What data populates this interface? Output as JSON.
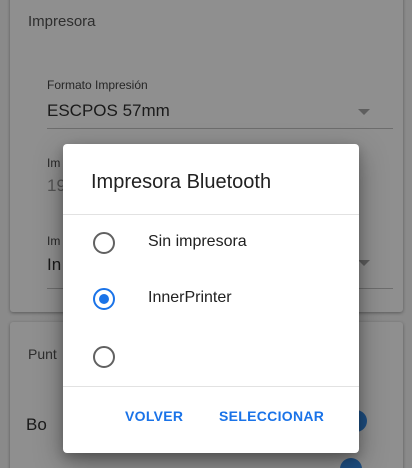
{
  "background": {
    "card1": {
      "section_title": "Impresora",
      "fields": [
        {
          "label": "Formato Impresión",
          "value": "ESCPOS 57mm"
        },
        {
          "label": "Im",
          "value": "19"
        },
        {
          "label": "Im",
          "value": "In"
        }
      ]
    },
    "card2": {
      "section_title": "Punt",
      "row_label": "Bo"
    }
  },
  "dialog": {
    "title": "Impresora Bluetooth",
    "options": [
      {
        "label": "Sin impresora",
        "checked": false
      },
      {
        "label": "InnerPrinter",
        "checked": true
      },
      {
        "label": "",
        "checked": false
      }
    ],
    "buttons": {
      "back": "VOLVER",
      "select": "SELECCIONAR"
    }
  },
  "colors": {
    "accent": "#1a73e8",
    "scrim": "#8a8a8a"
  }
}
